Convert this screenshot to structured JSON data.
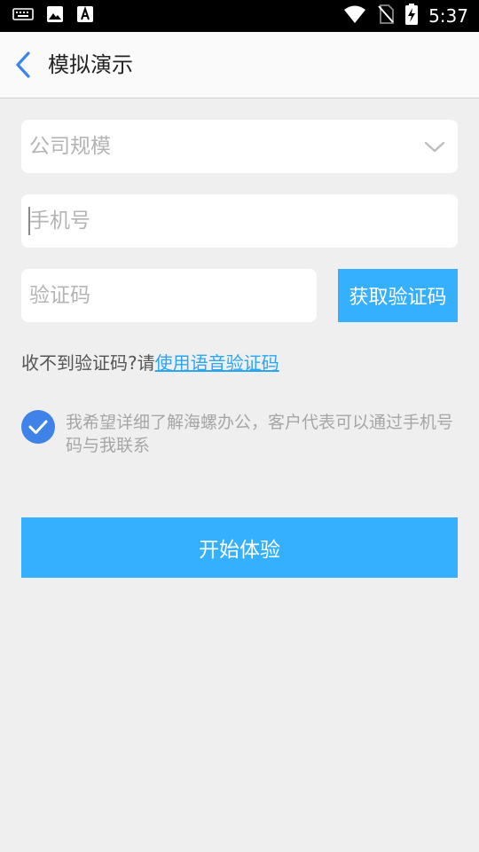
{
  "status_bar": {
    "time": "5:37",
    "icons": [
      "keyboard-icon",
      "image-icon",
      "font-icon",
      "wifi-icon",
      "no-sim-icon",
      "battery-charging-icon"
    ]
  },
  "header": {
    "title": "模拟演示",
    "back_icon": "chevron-left-icon"
  },
  "form": {
    "company_size": {
      "value": "公司规模",
      "icon": "chevron-down-icon"
    },
    "phone": {
      "placeholder": "手机号",
      "value": ""
    },
    "verification": {
      "placeholder": "验证码",
      "value": "",
      "button_label": "获取验证码"
    },
    "voice_hint": {
      "prefix": "收不到验证码?请",
      "link": "使用语音验证码"
    },
    "consent": {
      "checked": true,
      "text": "我希望详细了解海螺办公，客户代表可以通过手机号码与我联系"
    },
    "submit_label": "开始体验"
  },
  "colors": {
    "accent": "#35b0ff",
    "check": "#3f82e8",
    "link": "#2aa6f2",
    "background": "#efefef"
  }
}
